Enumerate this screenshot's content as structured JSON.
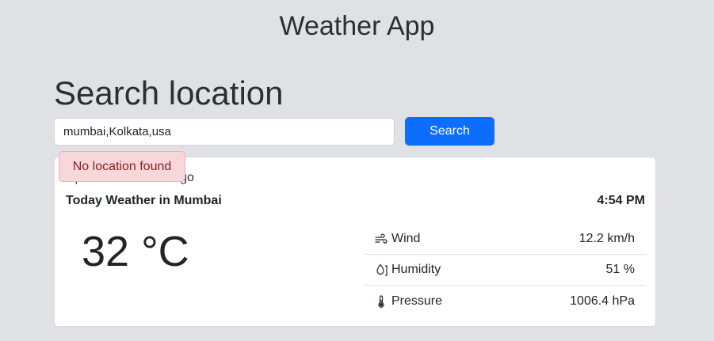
{
  "app": {
    "title": "Weather App"
  },
  "search": {
    "heading": "Search location",
    "input_value": "mumbai,Kolkata,usa",
    "button_label": "Search"
  },
  "alert": {
    "message": "No location found"
  },
  "card": {
    "updated": "Updated: 1 minute ago",
    "today_label": "Today Weather in Mumbai",
    "time": "4:54 PM",
    "temperature": "32 °C",
    "details": {
      "wind": {
        "label": "Wind",
        "value": "12.2 km/h",
        "icon": "wind-icon"
      },
      "humidity": {
        "label": "Humidity",
        "value": "51 %",
        "icon": "droplet-icon"
      },
      "pressure": {
        "label": "Pressure",
        "value": "1006.4 hPa",
        "icon": "thermometer-icon"
      }
    }
  }
}
